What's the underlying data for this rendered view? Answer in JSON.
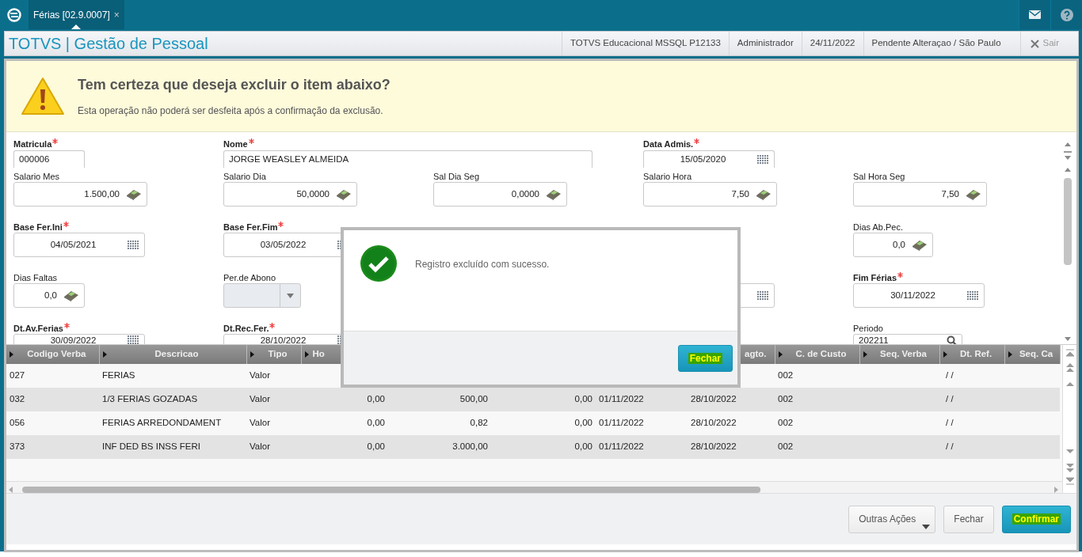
{
  "app_bar": {
    "tab": {
      "label": "Férias [02.9.0007]",
      "close": "×",
      "selected": true
    }
  },
  "header": {
    "title": "TOTVS | Gestão de Pessoal",
    "info": [
      "TOTVS Educacional MSSQL P12133",
      "Administrador",
      "24/11/2022",
      "Pendente Alteraçao / São Paulo"
    ],
    "exit": {
      "label": "Sair",
      "disabled": true
    }
  },
  "alert": {
    "title": "Tem certeza que deseja excluir o item abaixo?",
    "message": "Esta operação não poderá ser desfeita após a confirmação da exclusão."
  },
  "form": {
    "rows": [
      [
        {
          "label": "Matricula",
          "required": true,
          "kind": "text",
          "value": "000006"
        },
        {
          "label": "Nome",
          "required": true,
          "kind": "text",
          "value": "JORGE WEASLEY ALMEIDA"
        },
        null,
        {
          "label": "Data Admis.",
          "required": true,
          "kind": "date",
          "value": "15/05/2020"
        },
        null
      ],
      [
        {
          "label": "Salario Mes",
          "required": false,
          "kind": "money",
          "value": "1.500,00"
        },
        {
          "label": "Salario Dia",
          "required": false,
          "kind": "money",
          "value": "50,0000"
        },
        {
          "label": "Sal Dia Seg",
          "required": false,
          "kind": "money",
          "value": "0,0000"
        },
        {
          "label": "Salario Hora",
          "required": false,
          "kind": "money",
          "value": "7,50"
        },
        {
          "label": "Sal Hora Seg",
          "required": false,
          "kind": "money",
          "value": "7,50"
        }
      ],
      [
        {
          "label": "Base Fer.Ini",
          "required": true,
          "kind": "date",
          "value": "04/05/2021"
        },
        {
          "label": "Base Fer.Fim",
          "required": true,
          "kind": "date",
          "value": "03/05/2022"
        },
        null,
        null,
        {
          "label": "Dias Ab.Pec.",
          "required": false,
          "kind": "money",
          "value": "0,0"
        }
      ],
      [
        {
          "label": "Dias Faltas",
          "required": false,
          "kind": "money",
          "value": "0,0"
        },
        {
          "label": "Per.de Abono",
          "required": false,
          "kind": "select",
          "disabled": true
        },
        null,
        {
          "kind": "date"
        },
        {
          "label": "Fim Férias",
          "required": true,
          "kind": "date",
          "value": "30/11/2022"
        }
      ],
      [
        {
          "label": "Dt.Av.Ferias",
          "required": true,
          "kind": "date",
          "value": "30/09/2022"
        },
        {
          "label": "Dt.Rec.Fer.",
          "required": true,
          "kind": "date",
          "value": "28/10/2022"
        },
        null,
        null,
        {
          "label": "Periodo",
          "required": false,
          "kind": "search",
          "value": "202211"
        }
      ]
    ]
  },
  "table": {
    "columns": [
      {
        "label": "Codigo Verba"
      },
      {
        "label": "Descricao"
      },
      {
        "label": "Tipo"
      },
      {
        "label": "Ho"
      },
      {},
      {},
      {},
      {
        "label": "agto."
      },
      {
        "label": "C. de Custo"
      },
      {
        "label": "Seq. Verba"
      },
      {
        "label": "Dt. Ref."
      },
      {
        "label": "Seq. Ca"
      }
    ],
    "rows": [
      [
        "027",
        "FERIAS",
        "Valor",
        null,
        null,
        null,
        null,
        null,
        "002",
        null,
        "/  /",
        null
      ],
      [
        "032",
        "1/3 FERIAS GOZADAS",
        "Valor",
        "0,00",
        "500,00",
        "0,00",
        "01/11/2022",
        "28/10/2022",
        "002",
        null,
        "/  /",
        null
      ],
      [
        "056",
        "FERIAS ARREDONDAMENT",
        "Valor",
        "0,00",
        "0,82",
        "0,00",
        "01/11/2022",
        "28/10/2022",
        "002",
        null,
        "/  /",
        null
      ],
      [
        "373",
        "INF DED BS INSS FERI",
        "Valor",
        "0,00",
        "3.000,00",
        "0,00",
        "01/11/2022",
        "28/10/2022",
        "002",
        null,
        "/  /",
        null
      ]
    ]
  },
  "buttons": [
    {
      "label": "Outras Ações",
      "kind": "dropdown"
    },
    {
      "label": "Fechar",
      "kind": "default"
    },
    {
      "label": "Confirmar",
      "kind": "primary"
    }
  ],
  "dialog": {
    "message": "Registro excluído com sucesso.",
    "button": "Fechar"
  }
}
